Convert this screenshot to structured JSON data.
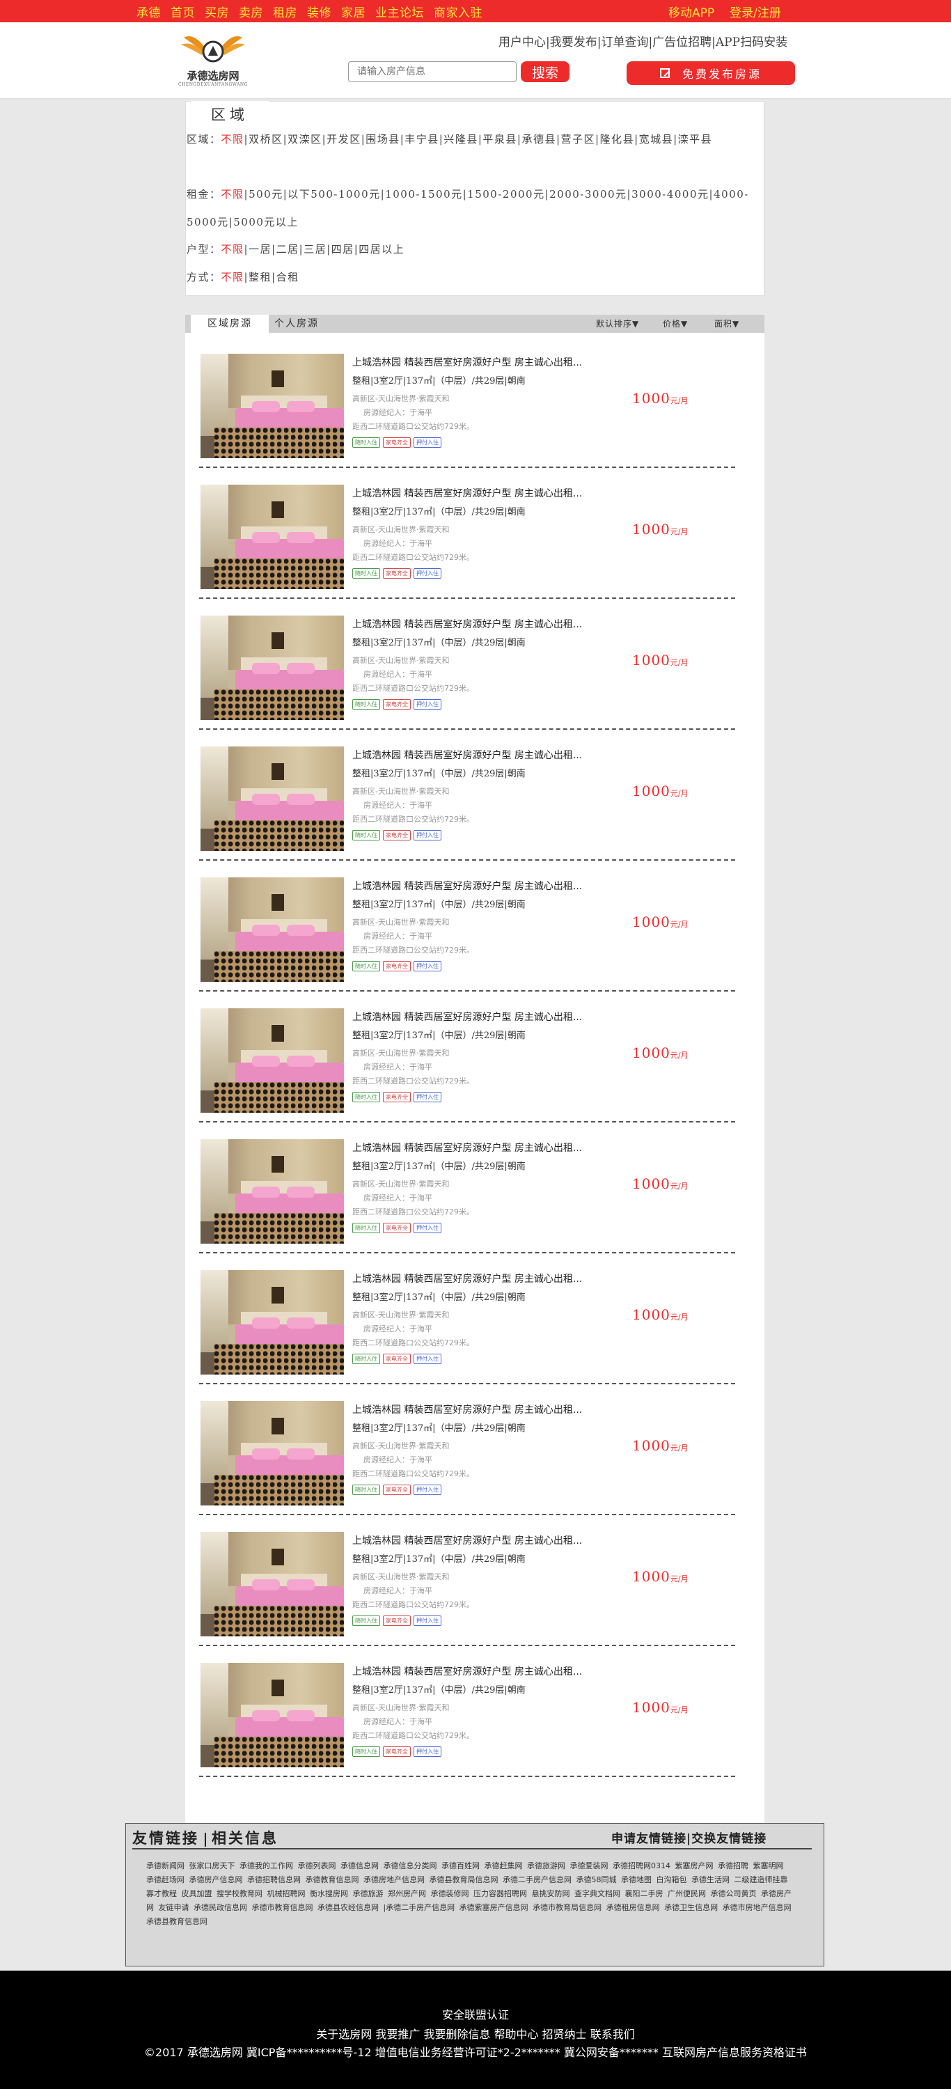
{
  "topbar": {
    "nav": [
      "承德",
      "首页",
      "买房",
      "卖房",
      "租房",
      "装修",
      "家居",
      "业主论坛",
      "商家入驻"
    ],
    "app": "移动APP",
    "login": "登录/注册"
  },
  "header": {
    "logo_name": "承德选房网",
    "logo_sub": "CHENGDEXUANFANGWANG",
    "user_links": "用户中心|我要发布|订单查询|广告位招聘|APP扫码安装",
    "search_placeholder": "请输入房产信息",
    "search_button": "搜索",
    "publish_button": "免费发布房源"
  },
  "filters": {
    "tab": "区域",
    "region": {
      "label": "区域：",
      "active": "不限",
      "options": "|双桥区|双滦区|开发区|围场县|丰宁县|兴隆县|平泉县|承德县|营子区|隆化县|宽城县|滦平县"
    },
    "rent": {
      "label": "租金：",
      "active": "不限",
      "options": "|500元|以下500-1000元|1000-1500元|1500-2000元|2000-3000元|3000-4000元|4000-5000元|5000元以上"
    },
    "layout": {
      "label": "户型：",
      "active": "不限",
      "options": "|一居|二居|三居|四居|四居以上"
    },
    "mode": {
      "label": "方式：",
      "active": "不限",
      "options": "|整租|合租"
    }
  },
  "listing": {
    "tabs": [
      "区域房源",
      "个人房源"
    ],
    "sorts": [
      "默认排序▼",
      "价格▼",
      "面积▼"
    ],
    "items": [
      {
        "title": "上城浩林园 精装西居室好房源好户型 房主诚心出租...",
        "spec": "整租|3室2厅|137㎡|（中层）/共29层|朝南",
        "addr": "高新区-天山海世界·紫霞天和",
        "agent": "房源经纪人：于海平",
        "traffic": "距西二环隧道路口公交站约729米。",
        "tags": [
          "随时入住",
          "家电齐全",
          "押付入住"
        ],
        "price": "1000",
        "unit": "元/月"
      },
      {
        "title": "上城浩林园 精装西居室好房源好户型 房主诚心出租...",
        "spec": "整租|3室2厅|137㎡|（中层）/共29层|朝南",
        "addr": "高新区-天山海世界·紫霞天和",
        "agent": "房源经纪人：于海平",
        "traffic": "距西二环隧道路口公交站约729米。",
        "tags": [
          "随时入住",
          "家电齐全",
          "押付入住"
        ],
        "price": "1000",
        "unit": "元/月"
      },
      {
        "title": "上城浩林园 精装西居室好房源好户型 房主诚心出租...",
        "spec": "整租|3室2厅|137㎡|（中层）/共29层|朝南",
        "addr": "高新区-天山海世界·紫霞天和",
        "agent": "房源经纪人：于海平",
        "traffic": "距西二环隧道路口公交站约729米。",
        "tags": [
          "随时入住",
          "家电齐全",
          "押付入住"
        ],
        "price": "1000",
        "unit": "元/月"
      },
      {
        "title": "上城浩林园 精装西居室好房源好户型 房主诚心出租...",
        "spec": "整租|3室2厅|137㎡|（中层）/共29层|朝南",
        "addr": "高新区-天山海世界·紫霞天和",
        "agent": "房源经纪人：于海平",
        "traffic": "距西二环隧道路口公交站约729米。",
        "tags": [
          "随时入住",
          "家电齐全",
          "押付入住"
        ],
        "price": "1000",
        "unit": "元/月"
      },
      {
        "title": "上城浩林园 精装西居室好房源好户型 房主诚心出租...",
        "spec": "整租|3室2厅|137㎡|（中层）/共29层|朝南",
        "addr": "高新区-天山海世界·紫霞天和",
        "agent": "房源经纪人：于海平",
        "traffic": "距西二环隧道路口公交站约729米。",
        "tags": [
          "随时入住",
          "家电齐全",
          "押付入住"
        ],
        "price": "1000",
        "unit": "元/月"
      },
      {
        "title": "上城浩林园 精装西居室好房源好户型 房主诚心出租...",
        "spec": "整租|3室2厅|137㎡|（中层）/共29层|朝南",
        "addr": "高新区-天山海世界·紫霞天和",
        "agent": "房源经纪人：于海平",
        "traffic": "距西二环隧道路口公交站约729米。",
        "tags": [
          "随时入住",
          "家电齐全",
          "押付入住"
        ],
        "price": "1000",
        "unit": "元/月"
      },
      {
        "title": "上城浩林园 精装西居室好房源好户型 房主诚心出租...",
        "spec": "整租|3室2厅|137㎡|（中层）/共29层|朝南",
        "addr": "高新区-天山海世界·紫霞天和",
        "agent": "房源经纪人：于海平",
        "traffic": "距西二环隧道路口公交站约729米。",
        "tags": [
          "随时入住",
          "家电齐全",
          "押付入住"
        ],
        "price": "1000",
        "unit": "元/月"
      },
      {
        "title": "上城浩林园 精装西居室好房源好户型 房主诚心出租...",
        "spec": "整租|3室2厅|137㎡|（中层）/共29层|朝南",
        "addr": "高新区-天山海世界·紫霞天和",
        "agent": "房源经纪人：于海平",
        "traffic": "距西二环隧道路口公交站约729米。",
        "tags": [
          "随时入住",
          "家电齐全",
          "押付入住"
        ],
        "price": "1000",
        "unit": "元/月"
      },
      {
        "title": "上城浩林园 精装西居室好房源好户型 房主诚心出租...",
        "spec": "整租|3室2厅|137㎡|（中层）/共29层|朝南",
        "addr": "高新区-天山海世界·紫霞天和",
        "agent": "房源经纪人：于海平",
        "traffic": "距西二环隧道路口公交站约729米。",
        "tags": [
          "随时入住",
          "家电齐全",
          "押付入住"
        ],
        "price": "1000",
        "unit": "元/月"
      },
      {
        "title": "上城浩林园 精装西居室好房源好户型 房主诚心出租...",
        "spec": "整租|3室2厅|137㎡|（中层）/共29层|朝南",
        "addr": "高新区-天山海世界·紫霞天和",
        "agent": "房源经纪人：于海平",
        "traffic": "距西二环隧道路口公交站约729米。",
        "tags": [
          "随时入住",
          "家电齐全",
          "押付入住"
        ],
        "price": "1000",
        "unit": "元/月"
      },
      {
        "title": "上城浩林园 精装西居室好房源好户型 房主诚心出租...",
        "spec": "整租|3室2厅|137㎡|（中层）/共29层|朝南",
        "addr": "高新区-天山海世界·紫霞天和",
        "agent": "房源经纪人：于海平",
        "traffic": "距西二环隧道路口公交站约729米。",
        "tags": [
          "随时入住",
          "家电齐全",
          "押付入住"
        ],
        "price": "1000",
        "unit": "元/月"
      }
    ]
  },
  "links": {
    "title_a": "友情链接",
    "title_b": "相关信息",
    "apply": "申请友情链接|交换友情链接",
    "text": "承德新闻网 张家口房天下 承德我的工作网 承德列表网 承德信息网 承德信息分类网 承德百姓网 承德赶集网 承德旅游网 承德爱装网 承德招聘网0314 紫塞房产网 承德招聘 紫塞明网 承德赶场网 承德房产信息网 承德招聘信息网 承德教育信息网 承德房地产信息网 承德县教育局信息网 承德二手房产信息网 承德58同城 承德地图 白沟箱包 承德生活网 二级建造师挂靠 寡才教程 皮具加盟 搜学校教育网 机械招聘网 衡水搜房网 承德旅游 郑州房产网 承德装修网 压力容器招聘网 悬挑安防网 查字典文档网 襄阳二手房 广州便民网 承德公司黄页 承德房产网 友链申请 承德民政信息网 承德市教育信息网 承德县农经信息网 |承德二手房产信息网 承德紫塞房产信息网 承德市教育局信息网 承德租房信息网 承德卫生信息网 承德市房地产信息网 承德县教育信息网"
  },
  "footer": {
    "line1": "安全联盟认证",
    "line2": "关于选房网 我要推广 我要删除信息 帮助中心 招贤纳士 联系我们",
    "line3": "©2017 承德选房网 冀ICP备**********号-12 增值电信业务经营许可证*2-2******* 冀公网安备******* 互联网房产信息服务资格证书"
  }
}
